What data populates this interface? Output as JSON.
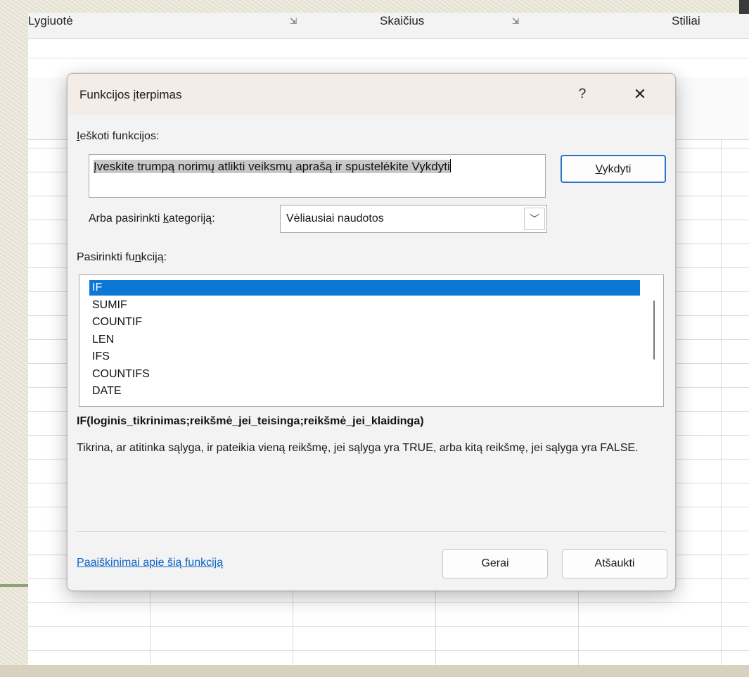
{
  "ribbon": {
    "group_align": "Lygiuotė",
    "group_number": "Skaičius",
    "group_styles": "Stiliai",
    "launcher_glyph": "⇲"
  },
  "dialog": {
    "title": "Funkcijos įterpimas",
    "help_glyph": "?",
    "close_glyph": "✕",
    "search_label_first": "I",
    "search_label_rest": "eškoti funkcijos:",
    "search_text": "Įveskite trumpą norimų atlikti veiksmų aprašą ir spustelėkite Vykdyti",
    "run_button_first": "V",
    "run_button_rest": "ykdyti",
    "category_label_pre": "Arba pasirinkti ",
    "category_label_u": "k",
    "category_label_post": "ategoriją:",
    "category_value": "Vėliausiai naudotos",
    "category_arrow_glyph": "﹀",
    "select_label_pre": "Pasirinkti fu",
    "select_label_u": "n",
    "select_label_post": "kciją:",
    "functions": [
      "IF",
      "SUMIF",
      "COUNTIF",
      "LEN",
      "IFS",
      "COUNTIFS",
      "DATE"
    ],
    "selected_function": "IF",
    "syntax": "IF(loginis_tikrinimas;reikšmė_jei_teisinga;reikšmė_jei_klaidinga)",
    "description": "Tikrina, ar atitinka sąlyga, ir pateikia vieną reikšmę, jei sąlyga yra TRUE, arba kitą reikšmę, jei sąlyga yra FALSE.",
    "help_link": "Paaiškinimai apie šią funkciją",
    "ok_label": "Gerai",
    "cancel_label": "Atšaukti"
  },
  "colors": {
    "selection": "#0a78d4",
    "link": "#0b62c4",
    "focus_border": "#2a74c8",
    "titlebar": "#f4ece6"
  }
}
